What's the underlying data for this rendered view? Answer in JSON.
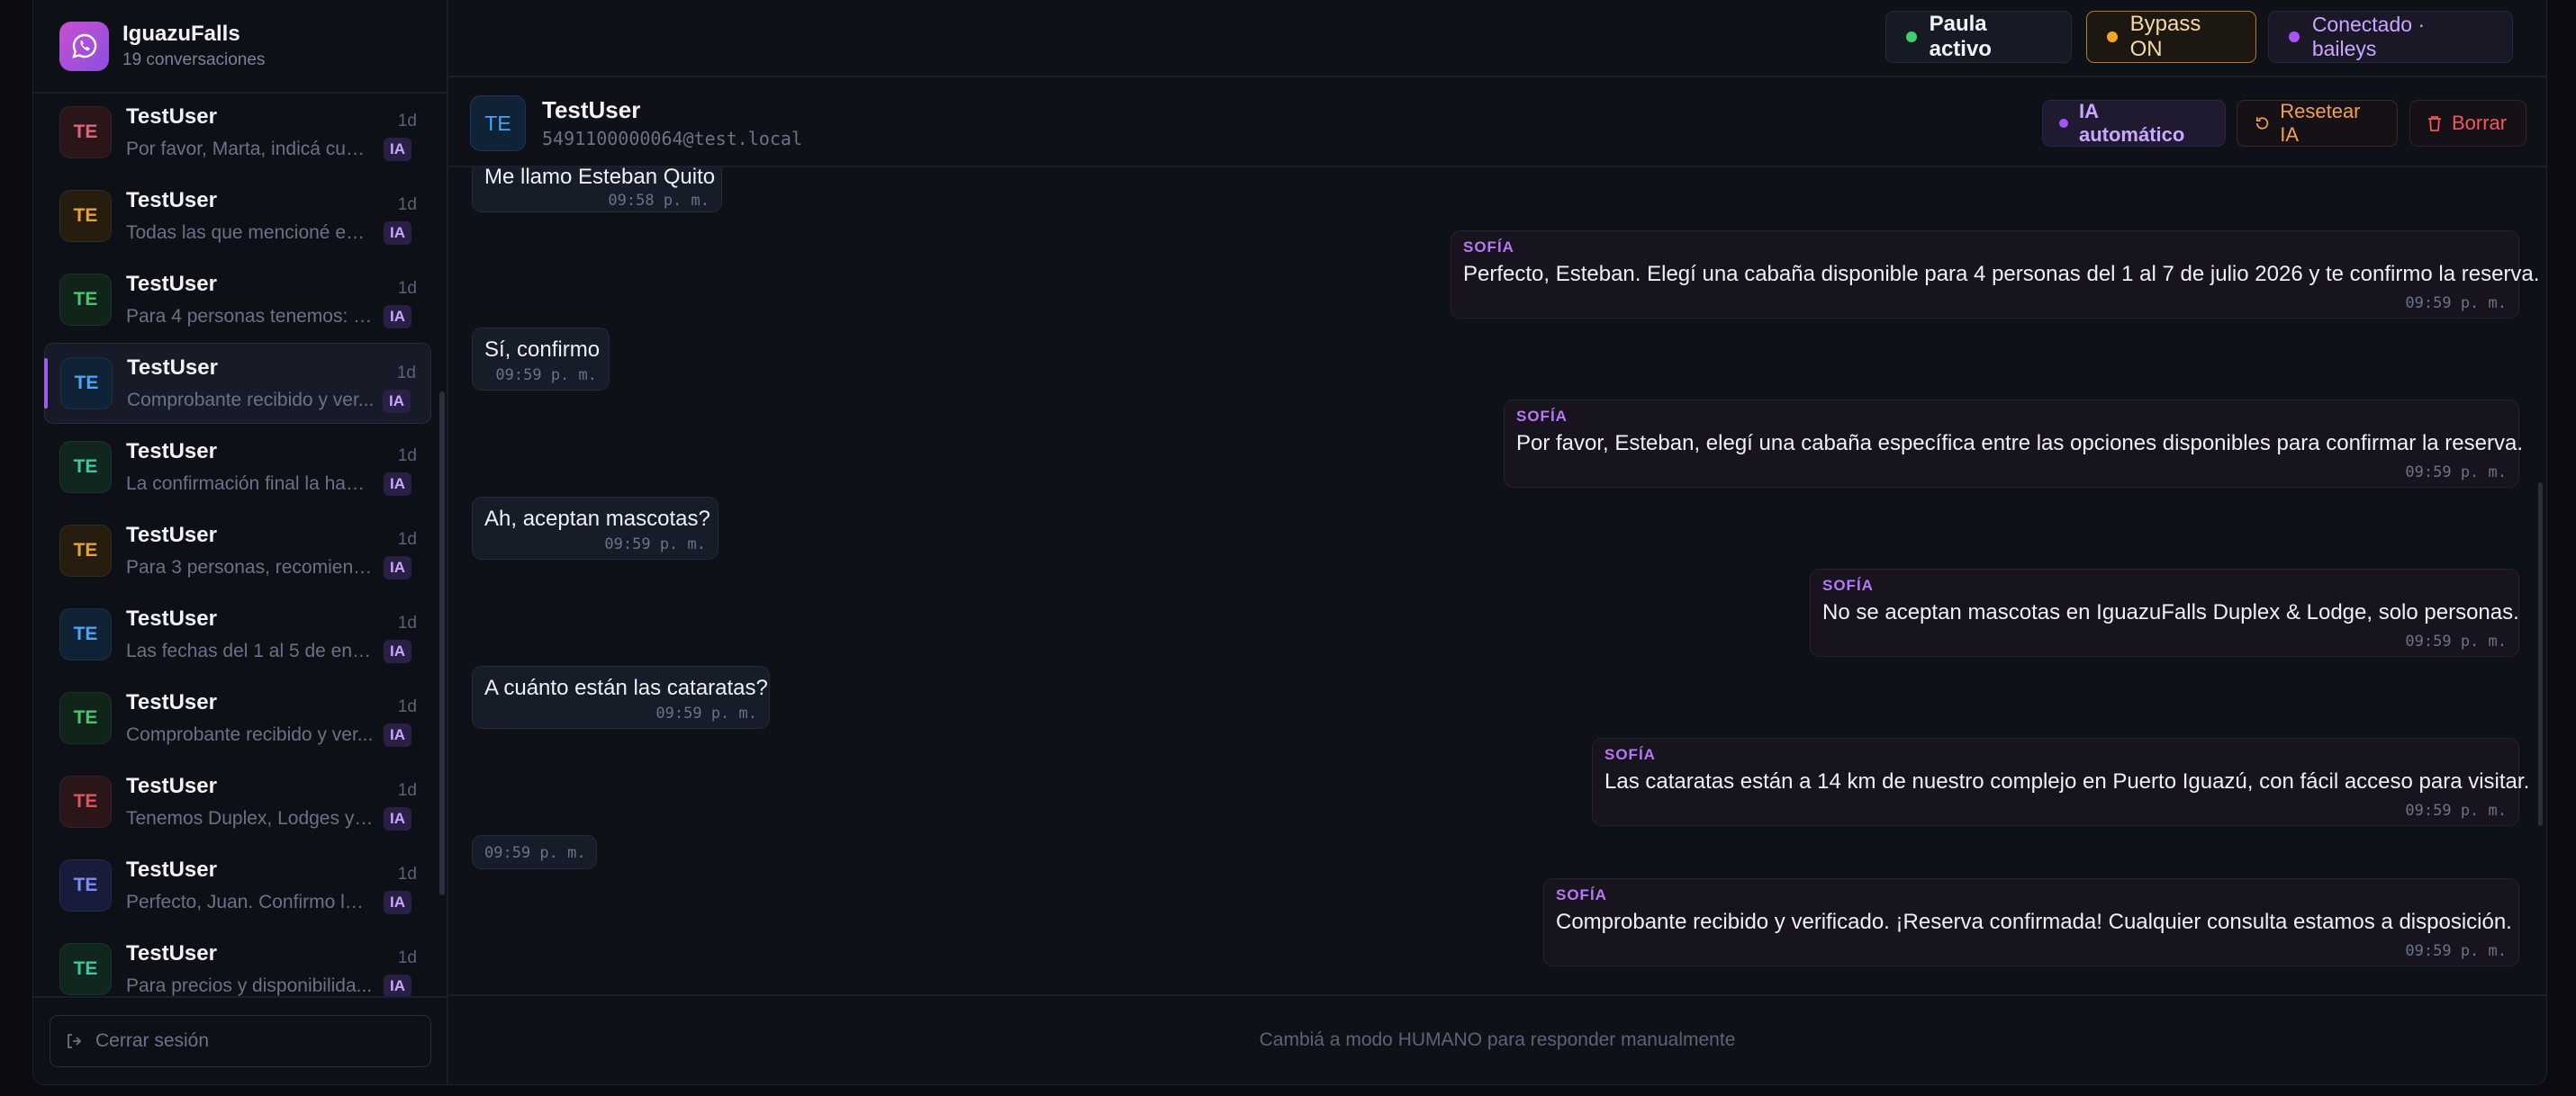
{
  "brand": {
    "name": "IguazuFalls",
    "subtitle": "19 conversaciones",
    "logo_icon": "whatsapp-icon"
  },
  "sidebar": {
    "conversations": [
      {
        "name": "TestUser",
        "initials": "TE",
        "preview": "Por favor, Marta, indicá cuál ...",
        "time": "1d",
        "badge": "IA",
        "color": "#e0647a",
        "bg": "#2a1519"
      },
      {
        "name": "TestUser",
        "initials": "TE",
        "preview": "Todas las que mencioné est...",
        "time": "1d",
        "badge": "IA",
        "color": "#e8a23a",
        "bg": "#261d0e"
      },
      {
        "name": "TestUser",
        "initials": "TE",
        "preview": "Para 4 personas tenemos: - ...",
        "time": "1d",
        "badge": "IA",
        "color": "#4cc46e",
        "bg": "#10241a"
      },
      {
        "name": "TestUser",
        "initials": "TE",
        "preview": "Comprobante recibido y ver...",
        "time": "1d",
        "badge": "IA",
        "color": "#4ea3f5",
        "bg": "#0f2236",
        "active": true
      },
      {
        "name": "TestUser",
        "initials": "TE",
        "preview": "La confirmación final la hace...",
        "time": "1d",
        "badge": "IA",
        "color": "#3fc7a0",
        "bg": "#10261f"
      },
      {
        "name": "TestUser",
        "initials": "TE",
        "preview": "Para 3 personas, recomiend...",
        "time": "1d",
        "badge": "IA",
        "color": "#e8a23a",
        "bg": "#261d0e"
      },
      {
        "name": "TestUser",
        "initials": "TE",
        "preview": "Las fechas del 1 al 5 de ener...",
        "time": "1d",
        "badge": "IA",
        "color": "#4ea3f5",
        "bg": "#0f2236"
      },
      {
        "name": "TestUser",
        "initials": "TE",
        "preview": "Comprobante recibido y ver...",
        "time": "1d",
        "badge": "IA",
        "color": "#4cc46e",
        "bg": "#10241a"
      },
      {
        "name": "TestUser",
        "initials": "TE",
        "preview": "Tenemos Duplex, Lodges y ...",
        "time": "1d",
        "badge": "IA",
        "color": "#e0545c",
        "bg": "#2a1519"
      },
      {
        "name": "TestUser",
        "initials": "TE",
        "preview": "Perfecto, Juan. Confirmo la r...",
        "time": "1d",
        "badge": "IA",
        "color": "#7b8cf5",
        "bg": "#171c3a"
      },
      {
        "name": "TestUser",
        "initials": "TE",
        "preview": "Para precios y disponibilida...",
        "time": "1d",
        "badge": "IA",
        "color": "#3fc7a0",
        "bg": "#10261f"
      }
    ],
    "logout_label": "Cerrar sesión"
  },
  "topbar": {
    "status_label": "Paula activo",
    "status_color": "#3ecf6a",
    "bypass_label": "Bypass ON",
    "bypass_color": "#f5a524",
    "connection_label": "Conectado · baileys",
    "connection_color": "#a855f7"
  },
  "chat": {
    "initials": "TE",
    "title": "TestUser",
    "subtitle": "5491100000064@test.local",
    "ia_mode_label": "IA automático",
    "reset_label": "Resetear IA",
    "delete_label": "Borrar",
    "messages": [
      {
        "dir": "in",
        "text": "Me llamo Esteban Quito",
        "time": "09:58 p. m."
      },
      {
        "dir": "out",
        "sender": "SOFÍA",
        "text": "Perfecto, Esteban. Elegí una cabaña disponible para 4 personas del 1 al 7 de julio 2026 y te confirmo la reserva.",
        "time": "09:59 p. m."
      },
      {
        "dir": "in",
        "text": "Sí, confirmo",
        "time": "09:59 p. m."
      },
      {
        "dir": "out",
        "sender": "SOFÍA",
        "text": "Por favor, Esteban, elegí una cabaña específica entre las opciones disponibles para confirmar la reserva.",
        "time": "09:59 p. m."
      },
      {
        "dir": "in",
        "text": "Ah, aceptan mascotas?",
        "time": "09:59 p. m."
      },
      {
        "dir": "out",
        "sender": "SOFÍA",
        "text": "No se aceptan mascotas en IguazuFalls Duplex & Lodge, solo personas.",
        "time": "09:59 p. m."
      },
      {
        "dir": "in",
        "text": "A cuánto están las cataratas?",
        "time": "09:59 p. m."
      },
      {
        "dir": "out",
        "sender": "SOFÍA",
        "text": "Las cataratas están a 14 km de nuestro complejo en Puerto Iguazú, con fácil acceso para visitar.",
        "time": "09:59 p. m."
      },
      {
        "dir": "in",
        "text": "",
        "time": "09:59 p. m."
      },
      {
        "dir": "out",
        "sender": "SOFÍA",
        "text": "Comprobante recibido y verificado. ¡Reserva confirmada! Cualquier consulta estamos a disposición.",
        "time": "09:59 p. m."
      }
    ],
    "footer_text": "Cambiá a modo HUMANO para responder manualmente"
  }
}
